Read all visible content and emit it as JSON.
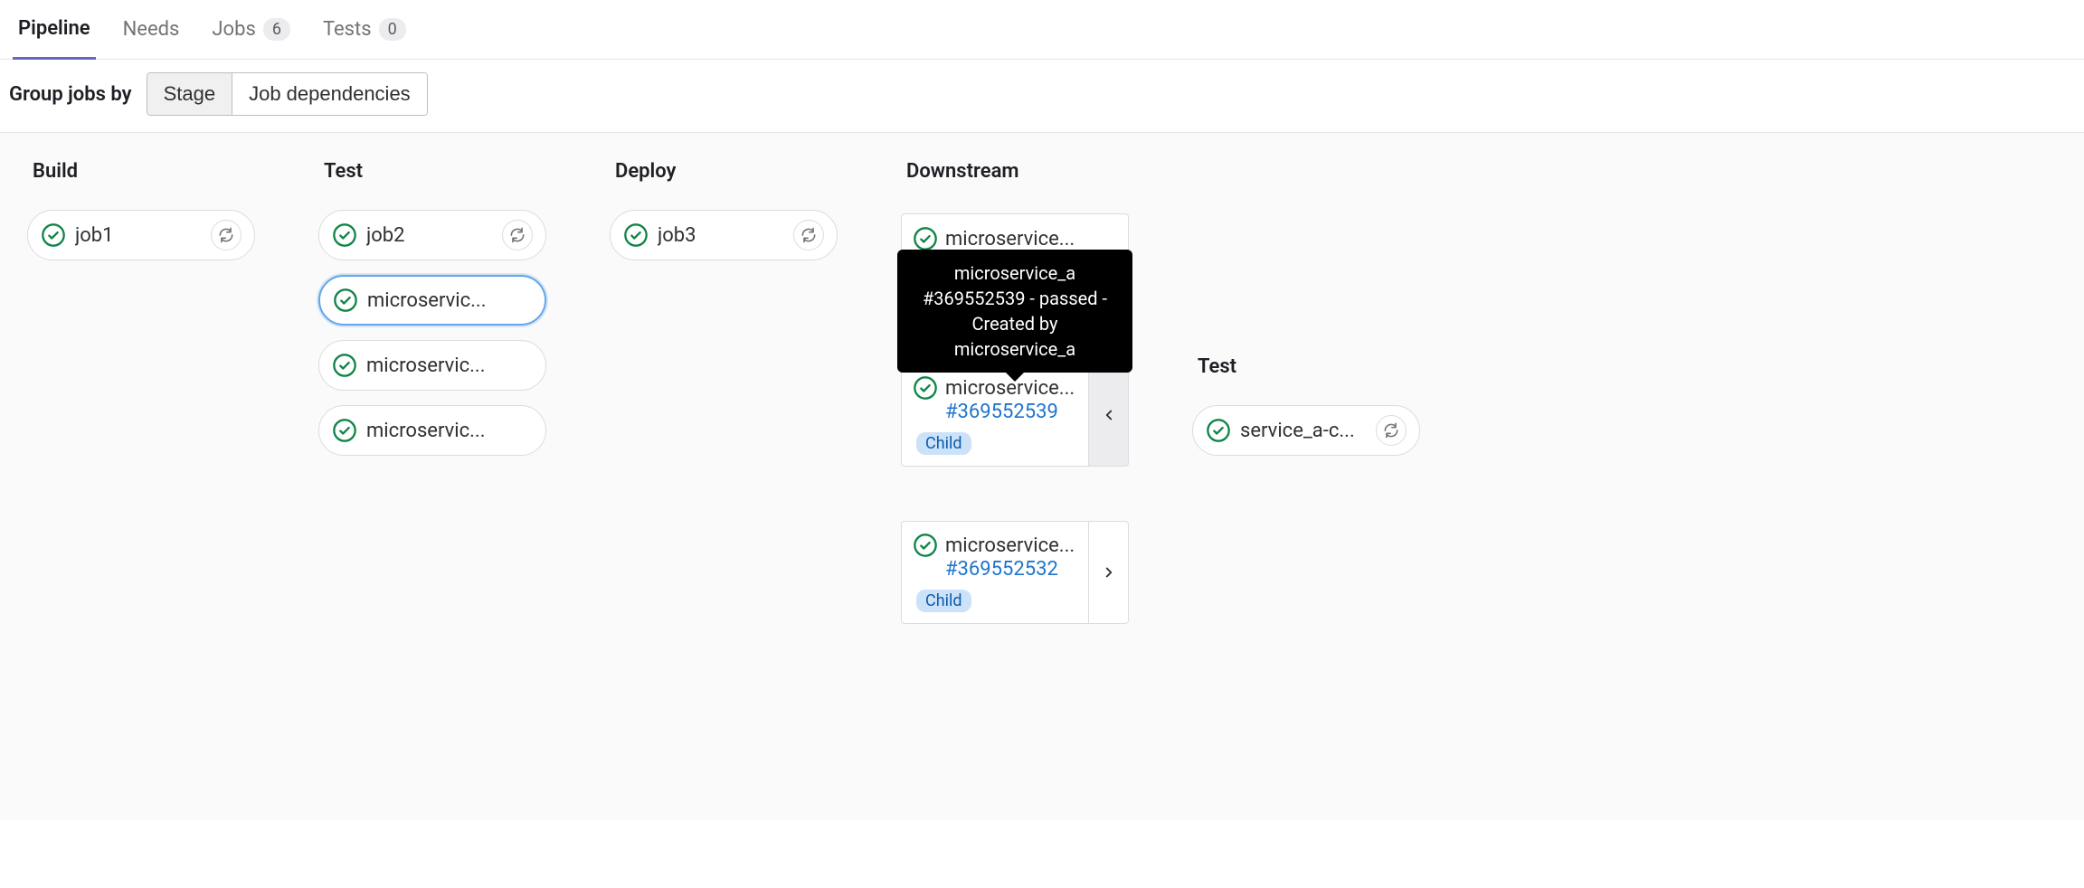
{
  "tabs": {
    "pipeline": "Pipeline",
    "needs": "Needs",
    "jobs": "Jobs",
    "jobs_count": "6",
    "tests": "Tests",
    "tests_count": "0"
  },
  "filter": {
    "label": "Group jobs by",
    "stage": "Stage",
    "deps": "Job dependencies"
  },
  "stages": {
    "build": "Build",
    "test": "Test",
    "deploy": "Deploy",
    "downstream": "Downstream"
  },
  "jobs": {
    "build": [
      {
        "name": "job1",
        "retry": true
      }
    ],
    "test": [
      {
        "name": "job2",
        "retry": true
      },
      {
        "name": "microservic...",
        "highlight": true
      },
      {
        "name": "microservic..."
      },
      {
        "name": "microservic..."
      }
    ],
    "deploy": [
      {
        "name": "job3",
        "retry": true
      }
    ]
  },
  "downstream": [
    {
      "name": "microservice...",
      "small": true
    },
    {
      "name": "microservice...",
      "pipeline_id": "#369552539",
      "child": "Child",
      "expanded": true
    },
    {
      "name": "microservice...",
      "pipeline_id": "#369552532",
      "child": "Child",
      "expanded": false
    }
  ],
  "tooltip": {
    "text": "microservice_a #369552539 - passed - Created by microservice_a"
  },
  "expanded_stage": {
    "title": "Test",
    "job": {
      "name": "service_a-c...",
      "retry": true
    }
  }
}
